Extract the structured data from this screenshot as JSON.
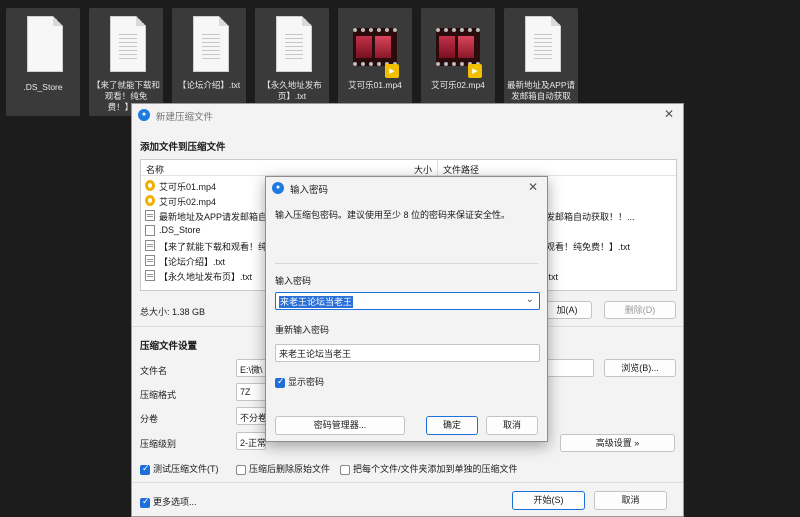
{
  "desktop": {
    "files": [
      {
        "name": ".DS_Store",
        "type": "blank"
      },
      {
        "name": "【来了就能下载和观看！纯免费！】.txt",
        "type": "doc"
      },
      {
        "name": "【论坛介绍】.txt",
        "type": "doc"
      },
      {
        "name": "【永久地址发布页】.txt",
        "type": "doc"
      },
      {
        "name": "艾可乐01.mp4",
        "type": "video",
        "badge": "Player"
      },
      {
        "name": "艾可乐02.mp4",
        "type": "video",
        "badge": "Player"
      },
      {
        "name": "最新地址及APP请发邮箱自动获取",
        "type": "doc"
      }
    ]
  },
  "main_window": {
    "title": "新建压缩文件",
    "add_files_heading": "添加文件到压缩文件",
    "columns": {
      "name": "名称",
      "size": "大小",
      "path": "文件路径"
    },
    "rows": [
      {
        "icon": "video",
        "name": "艾可乐01.mp4",
        "path": ""
      },
      {
        "icon": "video",
        "name": "艾可乐02.mp4",
        "path": ""
      },
      {
        "icon": "doc",
        "name": "最新地址及APP请发邮箱自动",
        "path": "请发邮箱自动获取！！..."
      },
      {
        "icon": "blank",
        "name": ".DS_Store",
        "path": ""
      },
      {
        "icon": "doc",
        "name": "【来了就能下载和观看！纯免",
        "path": "和观看！纯免费！】.txt"
      },
      {
        "icon": "doc",
        "name": "【论坛介绍】.txt",
        "path": ""
      },
      {
        "icon": "doc",
        "name": "【永久地址发布页】.txt",
        "path": "】.txt"
      }
    ],
    "total_size": "总大小: 1.38 GB",
    "add_button": "加(A)",
    "delete_button": "删除(D)",
    "settings_heading": "压缩文件设置",
    "filename_label": "文件名",
    "filename_value": "E:\\微\\",
    "browse_button": "浏览(B)...",
    "format_label": "压缩格式",
    "format_value": "7Z",
    "split_label": "分卷",
    "split_value": "不分卷",
    "level_label": "压缩级别",
    "level_value": "2-正常压缩",
    "advanced_button": "高级设置 »",
    "check_test": "测试压缩文件(T)",
    "check_delete": "压缩后删除原始文件",
    "check_separate": "把每个文件/文件夹添加到单独的压缩文件",
    "more_options": "更多选项...",
    "start_button": "开始(S)",
    "cancel_button": "取消"
  },
  "password_dialog": {
    "title": "输入密码",
    "hint": "输入压缩包密码。建议使用至少 8 位的密码来保证安全性。",
    "enter_label": "输入密码",
    "enter_value": "来老王论坛当老王",
    "reenter_label": "重新输入密码",
    "reenter_value": "来老王论坛当老王",
    "show_password": "显示密码",
    "manager_button": "密码管理器...",
    "ok_button": "确定",
    "cancel_button": "取消"
  }
}
